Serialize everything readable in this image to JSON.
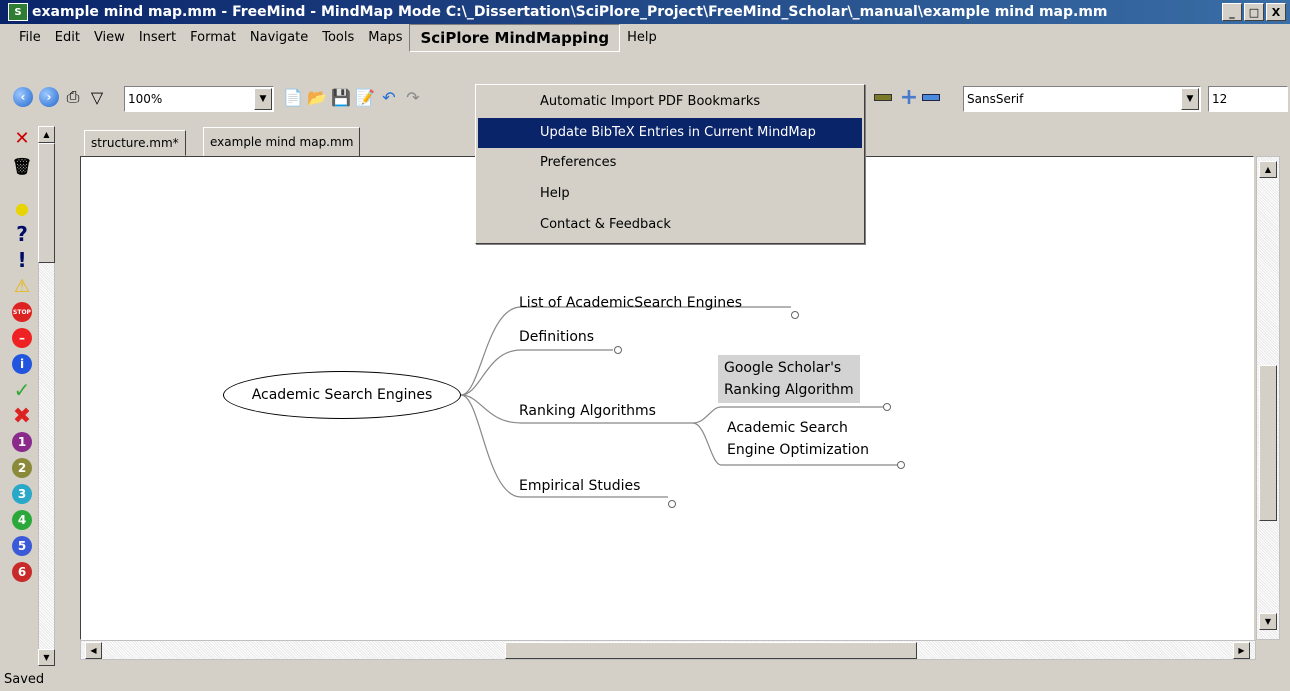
{
  "window": {
    "app_icon": "S",
    "title": "example mind map.mm - FreeMind - MindMap Mode C:\\_Dissertation\\SciPlore_Project\\FreeMind_Scholar\\_manual\\example mind map.mm",
    "minimize": "_",
    "maximize": "□",
    "close": "X"
  },
  "menubar": {
    "items": [
      "File",
      "Edit",
      "View",
      "Insert",
      "Format",
      "Navigate",
      "Tools",
      "Maps",
      "SciPlore MindMapping",
      "Help"
    ],
    "active": "SciPlore MindMapping"
  },
  "toolbar": {
    "zoom": "100%",
    "font": "SansSerif",
    "font_size": "12"
  },
  "dropdown": {
    "items": [
      "Automatic Import PDF Bookmarks",
      "Update BibTeX Entries in Current MindMap",
      "Preferences",
      "Help",
      "Contact & Feedback"
    ],
    "highlighted_index": 1
  },
  "tabs": [
    "structure.mm*",
    "example mind map.mm"
  ],
  "selected_tab": "example mind map.mm",
  "mindmap": {
    "root": "Academic Search Engines",
    "children": [
      {
        "label": "List of AcademicSearch Engines"
      },
      {
        "label": "Definitions"
      },
      {
        "label": "Ranking Algorithms",
        "children": [
          {
            "line1": "Google Scholar's",
            "line2": "Ranking Algorithm",
            "highlighted": true
          },
          {
            "line1": "Academic Search",
            "line2": "Engine Optimization"
          }
        ]
      },
      {
        "label": "Empirical Studies"
      }
    ]
  },
  "left_icons": {
    "numbers": [
      "1",
      "2",
      "3",
      "4",
      "5",
      "6"
    ],
    "info": "i",
    "question": "?",
    "exclamation": "!"
  },
  "status": "Saved",
  "colors": {
    "title_bar": "#0a246a",
    "menu_highlight": "#0a246a",
    "background": "#d4d0c8",
    "node_highlight": "#d3d3d3"
  }
}
